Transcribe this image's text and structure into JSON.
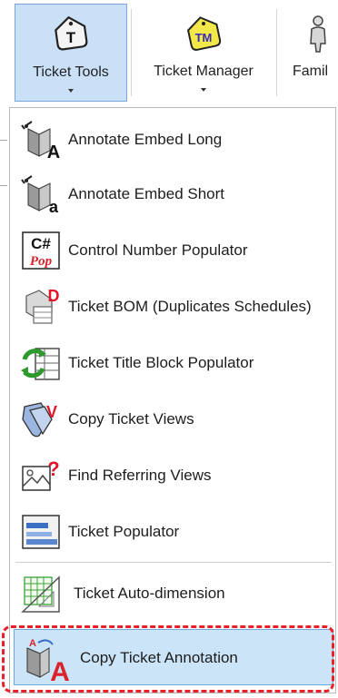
{
  "ribbon": {
    "buttons": [
      {
        "label": "Ticket Tools",
        "icon": "ticket-t-icon",
        "active": true
      },
      {
        "label": "Ticket Manager",
        "icon": "ticket-tm-icon",
        "active": false
      },
      {
        "label": "Famil",
        "icon": "family-icon",
        "active": false
      }
    ]
  },
  "menu": {
    "items": [
      {
        "label": "Annotate Embed Long",
        "icon": "annotate-embed-long-icon"
      },
      {
        "label": "Annotate Embed Short",
        "icon": "annotate-embed-short-icon"
      },
      {
        "label": "Control Number Populator",
        "icon": "control-number-populator-icon",
        "icon_text_top": "C#",
        "icon_text_bottom": "Pop"
      },
      {
        "label": "Ticket BOM (Duplicates Schedules)",
        "icon": "ticket-bom-icon",
        "icon_text": "D"
      },
      {
        "label": "Ticket Title Block Populator",
        "icon": "title-block-populator-icon"
      },
      {
        "label": "Copy Ticket Views",
        "icon": "copy-ticket-views-icon",
        "icon_text": "V"
      },
      {
        "label": "Find Referring Views",
        "icon": "find-referring-views-icon",
        "icon_text": "?"
      },
      {
        "label": "Ticket Populator",
        "icon": "ticket-populator-icon"
      },
      {
        "label": "Ticket Auto-dimension",
        "icon": "ticket-auto-dimension-icon"
      },
      {
        "label": "Copy Ticket Annotation",
        "icon": "copy-ticket-annotation-icon",
        "highlighted": true
      }
    ]
  },
  "colors": {
    "highlight_bg": "#cce4f7",
    "highlight_border": "#6ea8dc",
    "annotation_dash": "#e8202a",
    "accent_red": "#d9232d"
  }
}
